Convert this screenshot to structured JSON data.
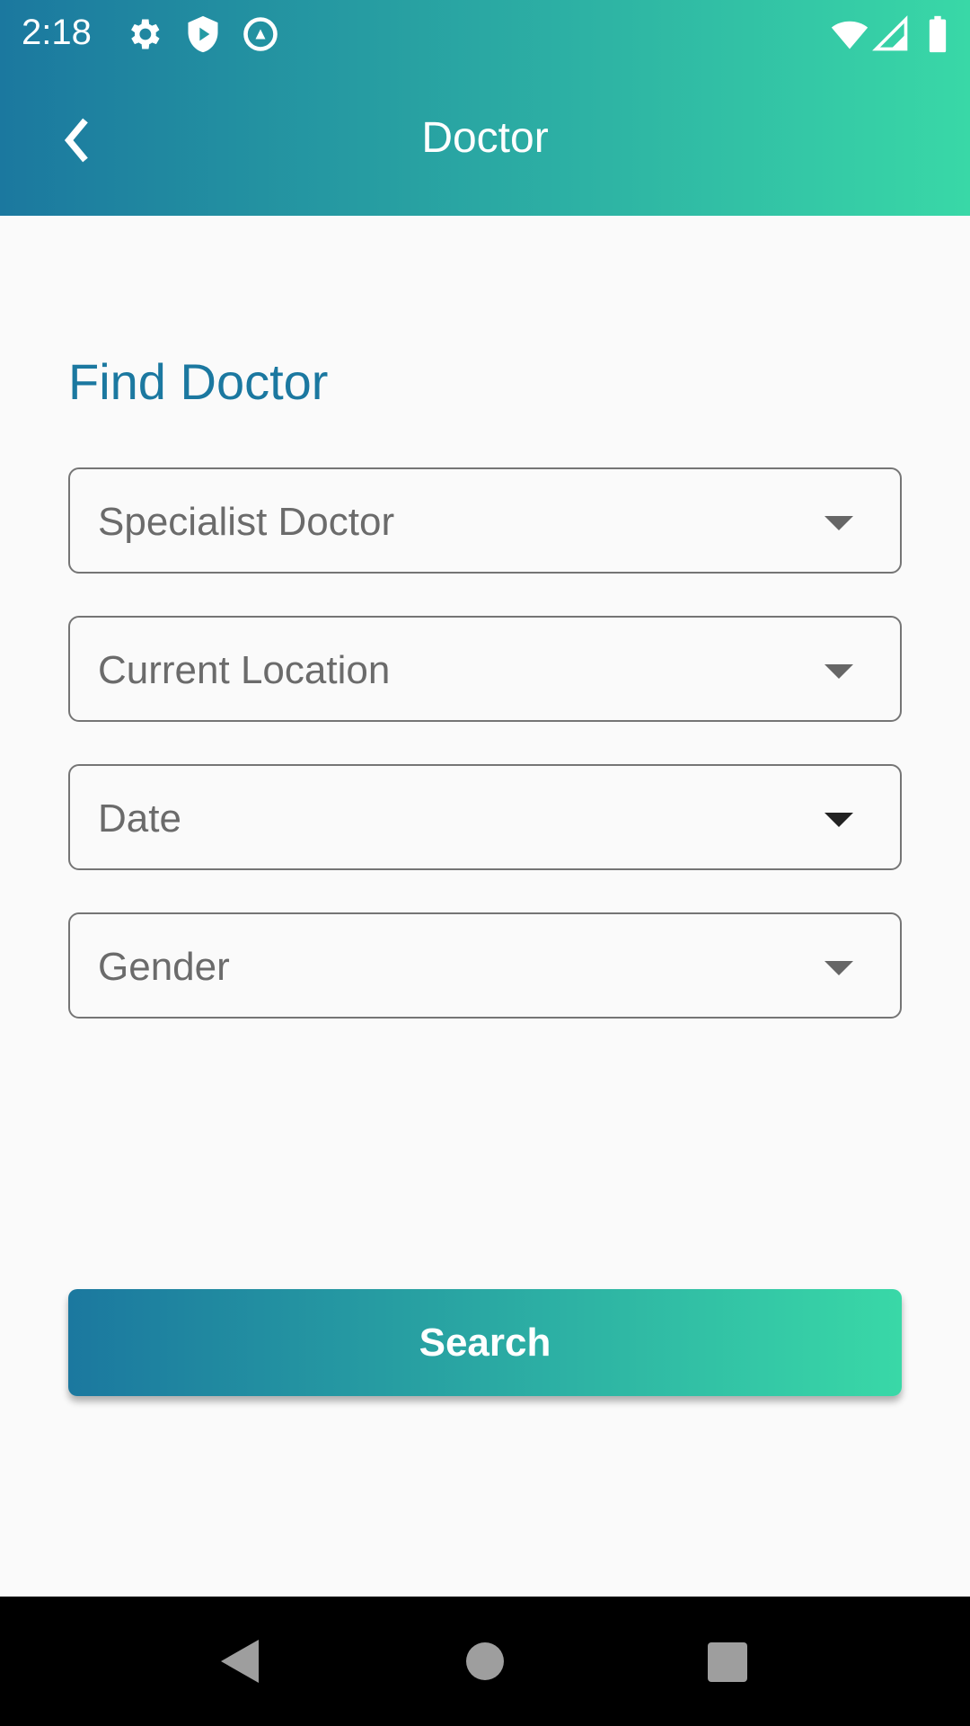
{
  "status_bar": {
    "time": "2:18"
  },
  "header": {
    "title": "Doctor"
  },
  "main": {
    "heading": "Find Doctor",
    "fields": [
      {
        "label": "Specialist Doctor"
      },
      {
        "label": "Current Location"
      },
      {
        "label": "Date"
      },
      {
        "label": "Gender"
      }
    ],
    "search_label": "Search"
  },
  "colors": {
    "accent": "#1b78a0",
    "gradient_start": "#1b789f",
    "gradient_end": "#39d8a7"
  }
}
